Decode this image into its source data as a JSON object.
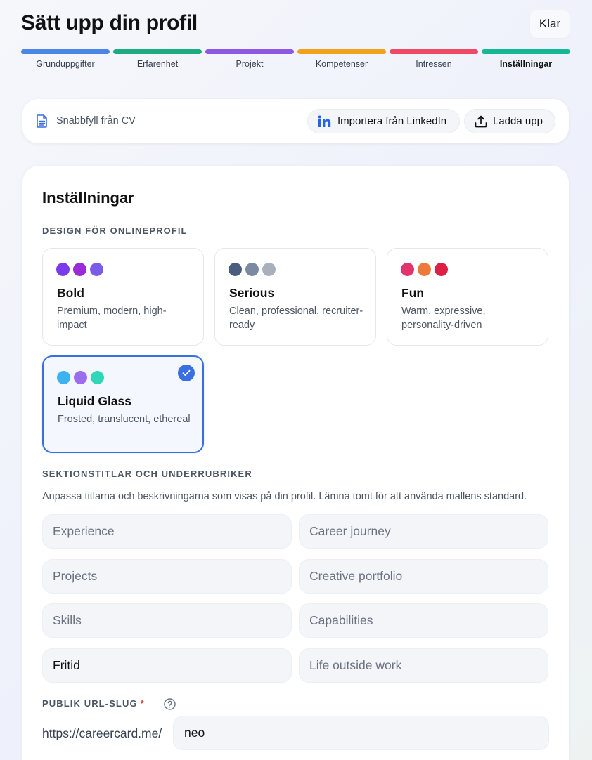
{
  "header": {
    "title": "Sätt upp din profil",
    "done_label": "Klar"
  },
  "steps": [
    {
      "label": "Grunduppgifter",
      "color": "#4a86e8",
      "active": false
    },
    {
      "label": "Erfarenhet",
      "color": "#1dab82",
      "active": false
    },
    {
      "label": "Projekt",
      "color": "#8e58e6",
      "active": false
    },
    {
      "label": "Kompetenser",
      "color": "#f2a11d",
      "active": false
    },
    {
      "label": "Intressen",
      "color": "#ee4a63",
      "active": false
    },
    {
      "label": "Inställningar",
      "color": "#15b894",
      "active": true
    }
  ],
  "quickfill": {
    "icon": "document-icon",
    "label": "Snabbfyll från CV",
    "linkedin_label": "Importera från LinkedIn",
    "upload_label": "Ladda upp"
  },
  "settings": {
    "title": "Inställningar",
    "design_heading": "DESIGN FÖR ONLINEPROFIL",
    "design_options": [
      {
        "name": "Bold",
        "description": "Premium, modern, high-impact",
        "colors": [
          "#7c3aed",
          "#9b2bd6",
          "#7b5ce8"
        ],
        "selected": false
      },
      {
        "name": "Serious",
        "description": "Clean, professional, recruiter-ready",
        "colors": [
          "#4b5d7e",
          "#7a8aa0",
          "#a9b0bc"
        ],
        "selected": false
      },
      {
        "name": "Fun",
        "description": "Warm, expressive, personality-driven",
        "colors": [
          "#e2336b",
          "#ec7a3a",
          "#dc1f44"
        ],
        "selected": false
      },
      {
        "name": "Liquid Glass",
        "description": "Frosted, translucent, ethereal",
        "colors": [
          "#3cb2f0",
          "#9b6ef0",
          "#2fd7b8"
        ],
        "selected": true
      }
    ],
    "section_heading": "SEKTIONSTITLAR OCH UNDERRUBRIKER",
    "section_helper": "Anpassa titlarna och beskrivningarna som visas på din profil. Lämna tomt för att använda mallens standard.",
    "section_fields": [
      {
        "title_value": "",
        "title_placeholder": "Experience",
        "subtitle_value": "",
        "subtitle_placeholder": "Career journey"
      },
      {
        "title_value": "",
        "title_placeholder": "Projects",
        "subtitle_value": "",
        "subtitle_placeholder": "Creative portfolio"
      },
      {
        "title_value": "",
        "title_placeholder": "Skills",
        "subtitle_value": "",
        "subtitle_placeholder": "Capabilities"
      },
      {
        "title_value": "Fritid",
        "title_placeholder": "",
        "subtitle_value": "",
        "subtitle_placeholder": "Life outside work"
      }
    ],
    "slug_heading": "PUBLIK URL-SLUG",
    "slug_required_mark": "*",
    "slug_prefix": "https://careercard.me/",
    "slug_value": "neo"
  }
}
